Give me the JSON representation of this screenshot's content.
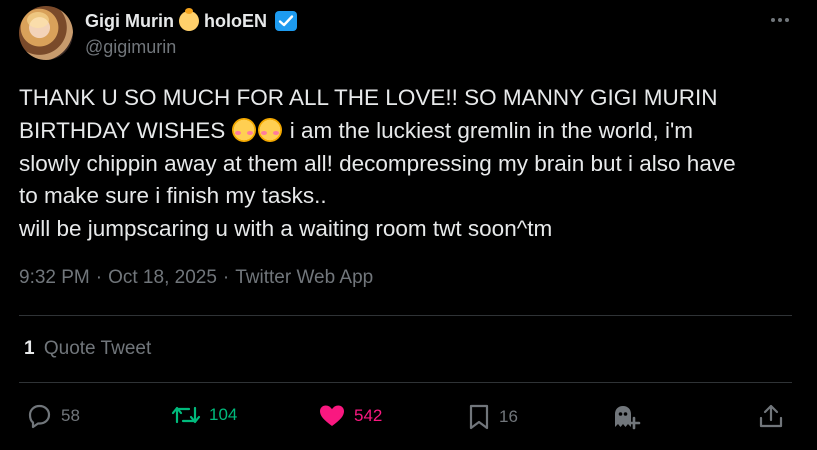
{
  "author": {
    "display_name": "Gigi Murin",
    "name_suffix": "holoEN",
    "handle": "@gigimurin"
  },
  "tweet": {
    "text_line1": "THANK U SO MUCH FOR ALL THE LOVE!! SO MANNY GIGI MURIN",
    "text_line2_a": "BIRTHDAY WISHES ",
    "text_line2_b": " i am the luckiest gremlin in the world, i'm",
    "text_line3": "slowly chippin away at them all! decompressing my brain but i also have",
    "text_line4": "to make sure i finish my tasks..",
    "text_line5": "will be jumpscaring u with a waiting room twt soon^tm"
  },
  "meta": {
    "time": "9:32 PM",
    "date": "Oct 18, 2025",
    "source": "Twitter Web App",
    "separator": "·"
  },
  "quotes": {
    "count": "1",
    "label": "Quote Tweet"
  },
  "actions": {
    "replies": "58",
    "retweets": "104",
    "likes": "542",
    "bookmarks": "16"
  },
  "colors": {
    "background": "#000000",
    "text": "#e7e9ea",
    "muted": "#71767b",
    "retweet": "#00ba7c",
    "like": "#f91880",
    "verified": "#1d9bf0"
  }
}
